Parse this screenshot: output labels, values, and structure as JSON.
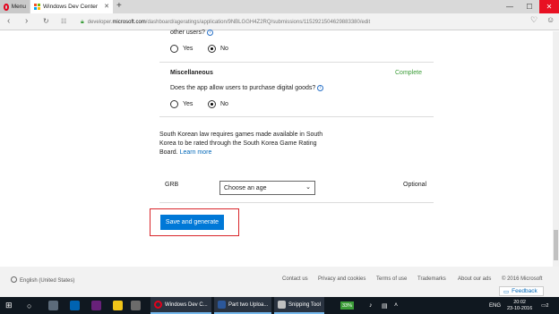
{
  "browser": {
    "menu_label": "Menu",
    "tab_title": "Windows Dev Center",
    "new_tab": "+",
    "url_prefix": "developer.",
    "url_domain": "microsoft.com",
    "url_path": "/dashboard/ageratings/application/9NBLGGH4Z2RQ/submissions/1152921504629883380/edit",
    "min_glyph": "—",
    "max_glyph": "☐",
    "close_glyph": "✕"
  },
  "form": {
    "prev_question_tail": "other users?",
    "prev_yes": "Yes",
    "prev_no": "No",
    "misc_heading": "Miscellaneous",
    "misc_status": "Complete",
    "misc_question": "Does the app allow users to purchase digital goods?",
    "misc_yes": "Yes",
    "misc_no": "No",
    "korea_notice_line1": "South Korean law requires games made available in South",
    "korea_notice_line2": "Korea to be rated through the South Korea Game Rating",
    "korea_notice_line3_prefix": "Board.",
    "korea_learn_more": "Learn more",
    "grb_label": "GRB",
    "grb_select_value": "Choose an age",
    "grb_optional": "Optional",
    "save_button": "Save and generate"
  },
  "footer": {
    "locale": "English (United States)",
    "contact": "Contact us",
    "privacy": "Privacy and cookies",
    "terms": "Terms of use",
    "trademarks": "Trademarks",
    "about_ads": "About our ads",
    "copyright": "© 2016 Microsoft",
    "feedback": "Feedback"
  },
  "taskbar": {
    "app1": "Windows Dev C...",
    "app2": "Part  two Uploa...",
    "app3": "Snipping Tool",
    "battery": "33%",
    "language": "ENG",
    "time": "20:02",
    "date": "23-10-2016",
    "notifications": "2"
  },
  "colors": {
    "accent": "#0078d7",
    "complete_green": "#3c9d38",
    "highlight_red": "#d9252a",
    "link": "#0067b8"
  }
}
